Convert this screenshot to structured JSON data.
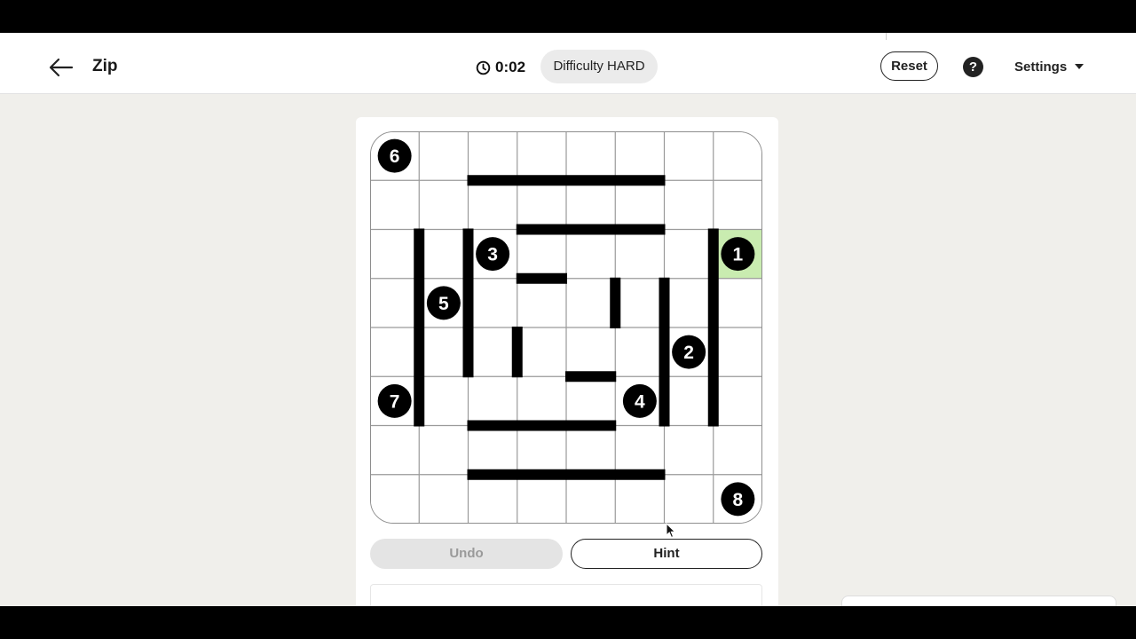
{
  "header": {
    "title": "Zip",
    "timer": "0:02",
    "difficulty": "Difficulty HARD",
    "reset_label": "Reset",
    "help_label": "?",
    "settings_label": "Settings"
  },
  "puzzle": {
    "rows": 8,
    "cols": 8,
    "start_cell": [
      2,
      7
    ],
    "highlight_color": "#c9ecb0",
    "numbers": [
      {
        "label": "1",
        "row": 2,
        "col": 7
      },
      {
        "label": "2",
        "row": 4,
        "col": 6
      },
      {
        "label": "3",
        "row": 2,
        "col": 2
      },
      {
        "label": "4",
        "row": 5,
        "col": 5
      },
      {
        "label": "5",
        "row": 3,
        "col": 1
      },
      {
        "label": "6",
        "row": 0,
        "col": 0
      },
      {
        "label": "7",
        "row": 5,
        "col": 0
      },
      {
        "label": "8",
        "row": 7,
        "col": 7
      }
    ],
    "walls": [
      {
        "dir": "h",
        "line": 1,
        "from": 2,
        "to": 6
      },
      {
        "dir": "h",
        "line": 2,
        "from": 3,
        "to": 6
      },
      {
        "dir": "h",
        "line": 3,
        "from": 3,
        "to": 4
      },
      {
        "dir": "h",
        "line": 5,
        "from": 4,
        "to": 5
      },
      {
        "dir": "h",
        "line": 6,
        "from": 2,
        "to": 5
      },
      {
        "dir": "h",
        "line": 7,
        "from": 2,
        "to": 6
      },
      {
        "dir": "v",
        "line": 1,
        "from": 2,
        "to": 6
      },
      {
        "dir": "v",
        "line": 2,
        "from": 2,
        "to": 5
      },
      {
        "dir": "v",
        "line": 3,
        "from": 4,
        "to": 5
      },
      {
        "dir": "v",
        "line": 5,
        "from": 3,
        "to": 4
      },
      {
        "dir": "v",
        "line": 6,
        "from": 3,
        "to": 6
      },
      {
        "dir": "v",
        "line": 7,
        "from": 2,
        "to": 6
      }
    ]
  },
  "controls": {
    "undo_label": "Undo",
    "hint_label": "Hint"
  }
}
